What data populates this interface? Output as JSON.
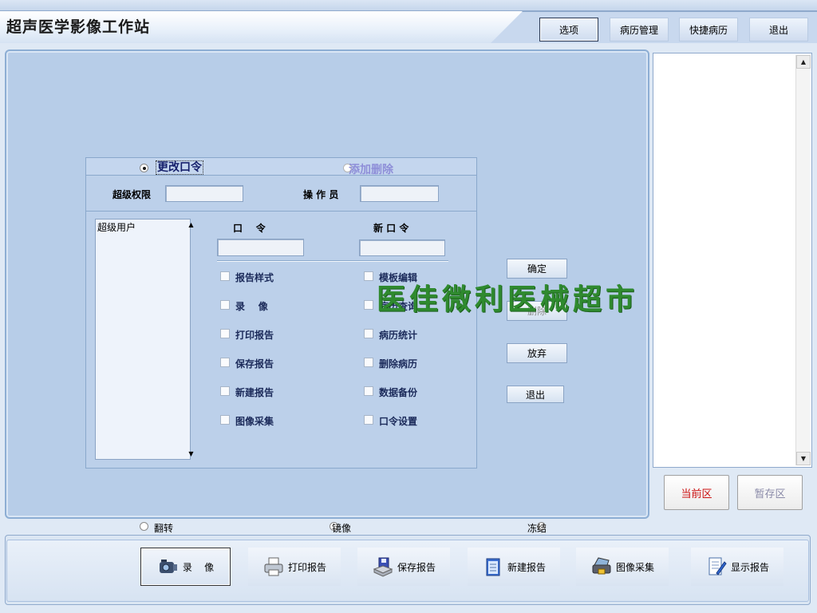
{
  "app": {
    "title": "超声医学影像工作站"
  },
  "topnav": {
    "options": "选项",
    "records": "病历管理",
    "quick": "快捷病历",
    "exit": "退出"
  },
  "dialog": {
    "radio_change_password": "更改口令",
    "radio_add_delete": "添加删除",
    "super_label": "超级权限",
    "operator_label": "操 作 员",
    "password_label": "口    令",
    "new_password_label": "新 口 令",
    "users": [
      "超级用户"
    ],
    "permissions_left": [
      "报告样式",
      "录    像",
      "打印报告",
      "保存报告",
      "新建报告",
      "图像采集"
    ],
    "permissions_right": [
      "模板编辑",
      "病历查询",
      "病历统计",
      "删除病历",
      "数据备份",
      "口令设置"
    ],
    "buttons": {
      "ok": "确定",
      "delete": "删除",
      "discard": "放弃",
      "exit": "退出"
    }
  },
  "watermark": "医佳微利医械超市",
  "right_panel": {
    "current": "当前区",
    "temp": "暂存区"
  },
  "view_options": [
    "翻转",
    "镜像",
    "冻结"
  ],
  "toolbar": [
    "录    像",
    "打印报告",
    "保存报告",
    "新建报告",
    "图像采集",
    "显示报告"
  ]
}
